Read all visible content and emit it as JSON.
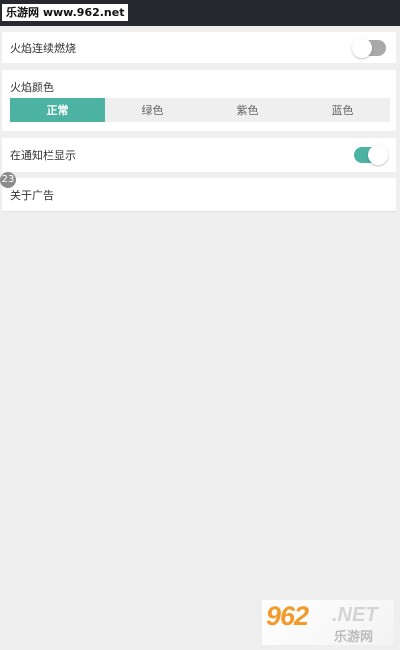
{
  "watermark_top": "乐游网 www.962.net",
  "settings": {
    "flame_continuous": {
      "label": "火焰连续燃烧",
      "enabled": false
    },
    "flame_color": {
      "label": "火焰颜色",
      "options": [
        "正常",
        "绿色",
        "紫色",
        "蓝色"
      ],
      "selected": "正常"
    },
    "notification_display": {
      "label": "在通知栏显示",
      "enabled": true
    },
    "about_ads": {
      "label": "关于广告"
    }
  },
  "badge": "23",
  "logo": {
    "number": "962",
    "net": ".NET",
    "name": "乐游网"
  },
  "colors": {
    "accent": "#4cb3a3",
    "toggle_off": "#a9a9a9",
    "background": "#efefef"
  }
}
